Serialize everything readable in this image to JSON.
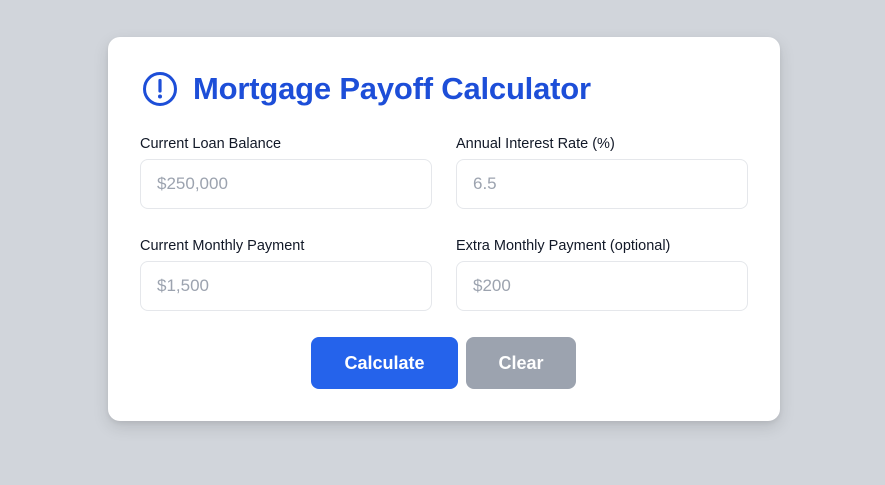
{
  "app": {
    "title": "Mortgage Payoff Calculator",
    "title_icon": "exclamation-circle-icon",
    "accent_color": "#1d4ed8"
  },
  "form": {
    "fields": [
      {
        "label": "Current Loan Balance",
        "placeholder": "$250,000",
        "value": ""
      },
      {
        "label": "Annual Interest Rate (%)",
        "placeholder": "6.5",
        "value": ""
      },
      {
        "label": "Current Monthly Payment",
        "placeholder": "$1,500",
        "value": ""
      },
      {
        "label": "Extra Monthly Payment (optional)",
        "placeholder": "$200",
        "value": ""
      }
    ]
  },
  "buttons": {
    "calculate_label": "Calculate",
    "calculate_color": "#2563eb",
    "clear_label": "Clear",
    "clear_color": "#9ca3af"
  }
}
